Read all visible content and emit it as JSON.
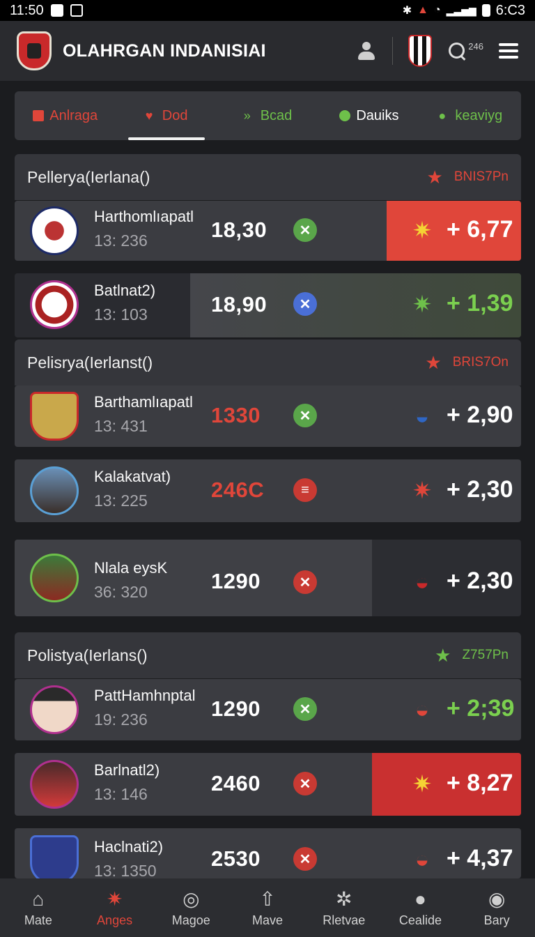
{
  "status_bar": {
    "time_left": "11:50",
    "time_right": "6:C3"
  },
  "app": {
    "title": "OLAHRGAN INDANISIAI",
    "search_count": "246"
  },
  "tabs": [
    {
      "label": "Anlraga",
      "color": "#e0463a",
      "icon": "list-icon"
    },
    {
      "label": "Dod",
      "color": "#e0463a",
      "icon": "heart-icon",
      "active": true
    },
    {
      "label": "Bcad",
      "color": "#6ec04a",
      "icon": "chevrons-icon"
    },
    {
      "label": "Dauiks",
      "color": "#ffffff",
      "icon": "heart-badge-icon"
    },
    {
      "label": "keaviyg",
      "color": "#6ec04a",
      "icon": "pin-icon"
    }
  ],
  "sections": [
    {
      "title": "Pellerya(Ierlana()",
      "badge": "BNIS7Pn",
      "badge_color": "#e0463a"
    },
    {
      "title": "Pelisrya(Ierlanst()",
      "badge": "BRIS7On",
      "badge_color": "#e0463a"
    },
    {
      "title": "Polistya(Ierlans()",
      "badge": "Z757Pn",
      "badge_color": "#6ec04a"
    }
  ],
  "rows": [
    {
      "name": "Harthomlıapatl",
      "stat": "13: 236",
      "score": "18,30",
      "score_color": "#ffffff",
      "status_icon": "check-icon",
      "status_color": "#5aa64a",
      "delta": "+ 6,77",
      "delta_color": "#ffffff",
      "badge_icon": "star-badge-icon"
    },
    {
      "name": "Batlnat2)",
      "stat": "13: 103",
      "score": "18,90",
      "score_color": "#ffffff",
      "status_icon": "close-icon",
      "status_color": "#4a6fd6",
      "delta": "+ 1,39",
      "delta_color": "#7bd04f",
      "badge_icon": "star-badge-icon"
    },
    {
      "name": "Barthamlıapatl",
      "stat": "13: 431",
      "score": "1330",
      "score_color": "#e0463a",
      "status_icon": "check-icon",
      "status_color": "#5aa64a",
      "delta": "+ 2,90",
      "delta_color": "#ffffff",
      "badge_icon": "helmet-icon"
    },
    {
      "name": "Kalakatvat)",
      "stat": "13: 225",
      "score": "246C",
      "score_color": "#e0463a",
      "status_icon": "minus-icon",
      "status_color": "#c93a33",
      "delta": "+ 2,30",
      "delta_color": "#ffffff",
      "badge_icon": "star-badge-icon"
    },
    {
      "name": "Nlala eysK",
      "stat": "36: 320",
      "score": "1290",
      "score_color": "#ffffff",
      "status_icon": "close-icon",
      "status_color": "#c93a33",
      "delta": "+ 2,30",
      "delta_color": "#ffffff",
      "badge_icon": "helmet-icon"
    },
    {
      "name": "PattHamhnptal",
      "stat": "19: 236",
      "score": "1290",
      "score_color": "#ffffff",
      "status_icon": "check-icon",
      "status_color": "#5aa64a",
      "delta": "+ 2;39",
      "delta_color": "#7bd04f",
      "badge_icon": "helmet-icon"
    },
    {
      "name": "Barlnatl2)",
      "stat": "13: 146",
      "score": "2460",
      "score_color": "#ffffff",
      "status_icon": "close-icon",
      "status_color": "#c93a33",
      "delta": "+ 8,27",
      "delta_color": "#ffffff",
      "badge_icon": "star-badge-icon"
    },
    {
      "name": "Haclnati2)",
      "stat": "13: 1350",
      "score": "2530",
      "score_color": "#ffffff",
      "status_icon": "close-icon",
      "status_color": "#c93a33",
      "delta": "+ 4,37",
      "delta_color": "#ffffff",
      "badge_icon": "helmet-icon"
    }
  ],
  "bottom_nav": [
    {
      "label": "Mate",
      "icon": "home-icon"
    },
    {
      "label": "Anges",
      "icon": "star-burst-icon",
      "active": true
    },
    {
      "label": "Magoe",
      "icon": "ball-icon"
    },
    {
      "label": "Mave",
      "icon": "house-upload-icon"
    },
    {
      "label": "Rletvae",
      "icon": "search-gear-icon"
    },
    {
      "label": "Cealide",
      "icon": "person-icon"
    },
    {
      "label": "Bary",
      "icon": "avatar-icon"
    }
  ]
}
